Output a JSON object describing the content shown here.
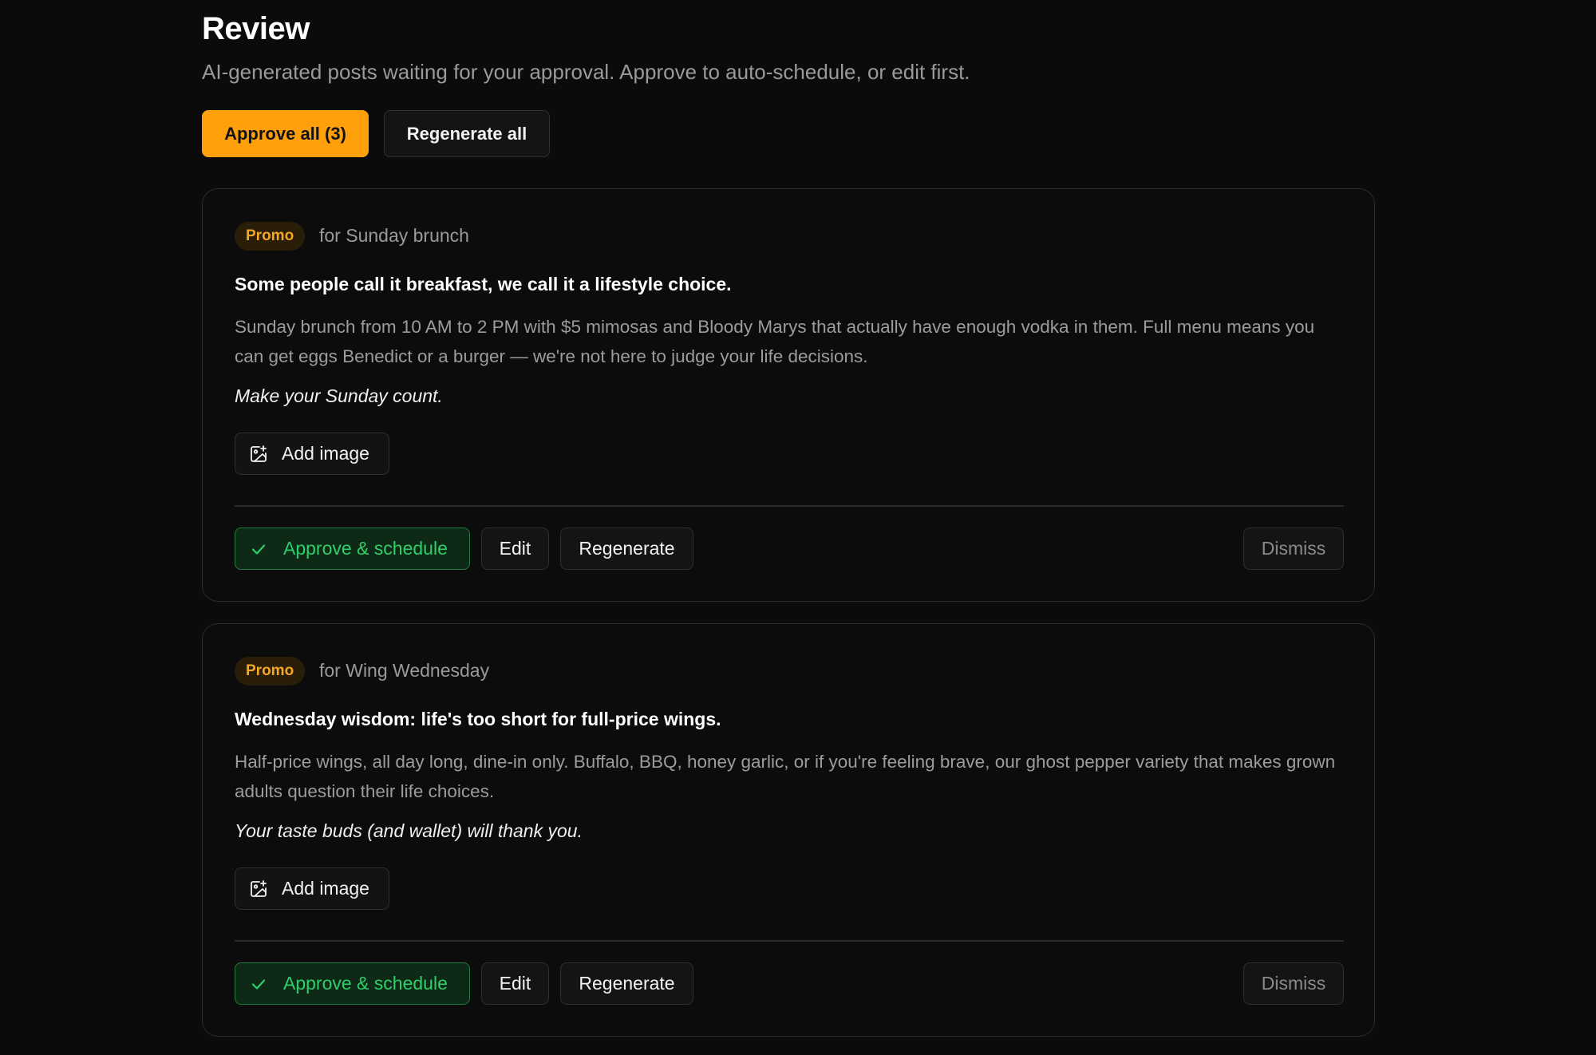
{
  "header": {
    "title": "Review",
    "subtitle": "AI-generated posts waiting for your approval. Approve to auto-schedule, or edit first."
  },
  "bulk_actions": {
    "approve_all_label": "Approve all (3)",
    "regenerate_all_label": "Regenerate all"
  },
  "colors": {
    "accent": "#ff9f0a",
    "approve_green": "#2ecf6a",
    "badge_text": "#f5a623",
    "background": "#0b0b0b"
  },
  "posts": [
    {
      "badge": "Promo",
      "for_label": "for Sunday brunch",
      "headline": "Some people call it breakfast, we call it a lifestyle choice.",
      "body": "Sunday brunch from 10 AM to 2 PM with $5 mimosas and Bloody Marys that actually have enough vodka in them. Full menu means you can get eggs Benedict or a burger — we're not here to judge your life decisions.",
      "cta": "Make your Sunday count.",
      "add_image_label": "Add image",
      "approve_label": "Approve & schedule",
      "edit_label": "Edit",
      "regenerate_label": "Regenerate",
      "dismiss_label": "Dismiss"
    },
    {
      "badge": "Promo",
      "for_label": "for Wing Wednesday",
      "headline": "Wednesday wisdom: life's too short for full-price wings.",
      "body": "Half-price wings, all day long, dine-in only. Buffalo, BBQ, honey garlic, or if you're feeling brave, our ghost pepper variety that makes grown adults question their life choices.",
      "cta": "Your taste buds (and wallet) will thank you.",
      "add_image_label": "Add image",
      "approve_label": "Approve & schedule",
      "edit_label": "Edit",
      "regenerate_label": "Regenerate",
      "dismiss_label": "Dismiss"
    }
  ],
  "icons": {
    "add_image": "image-plus-icon",
    "approve": "check-icon"
  }
}
